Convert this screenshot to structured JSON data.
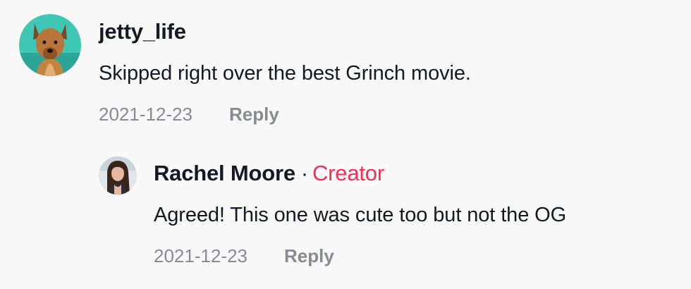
{
  "comments": [
    {
      "username": "jetty_life",
      "text": "Skipped right over the best Grinch movie.",
      "date": "2021-12-23",
      "reply_label": "Reply"
    }
  ],
  "replies": [
    {
      "username": "Rachel Moore",
      "separator": "·",
      "badge": "Creator",
      "text": "Agreed! This one was cute too but not the OG",
      "date": "2021-12-23",
      "reply_label": "Reply"
    }
  ],
  "colors": {
    "background": "#f8f8f8",
    "text": "#161823",
    "muted": "#8a8b91",
    "creator_accent": "#fe2c55"
  }
}
